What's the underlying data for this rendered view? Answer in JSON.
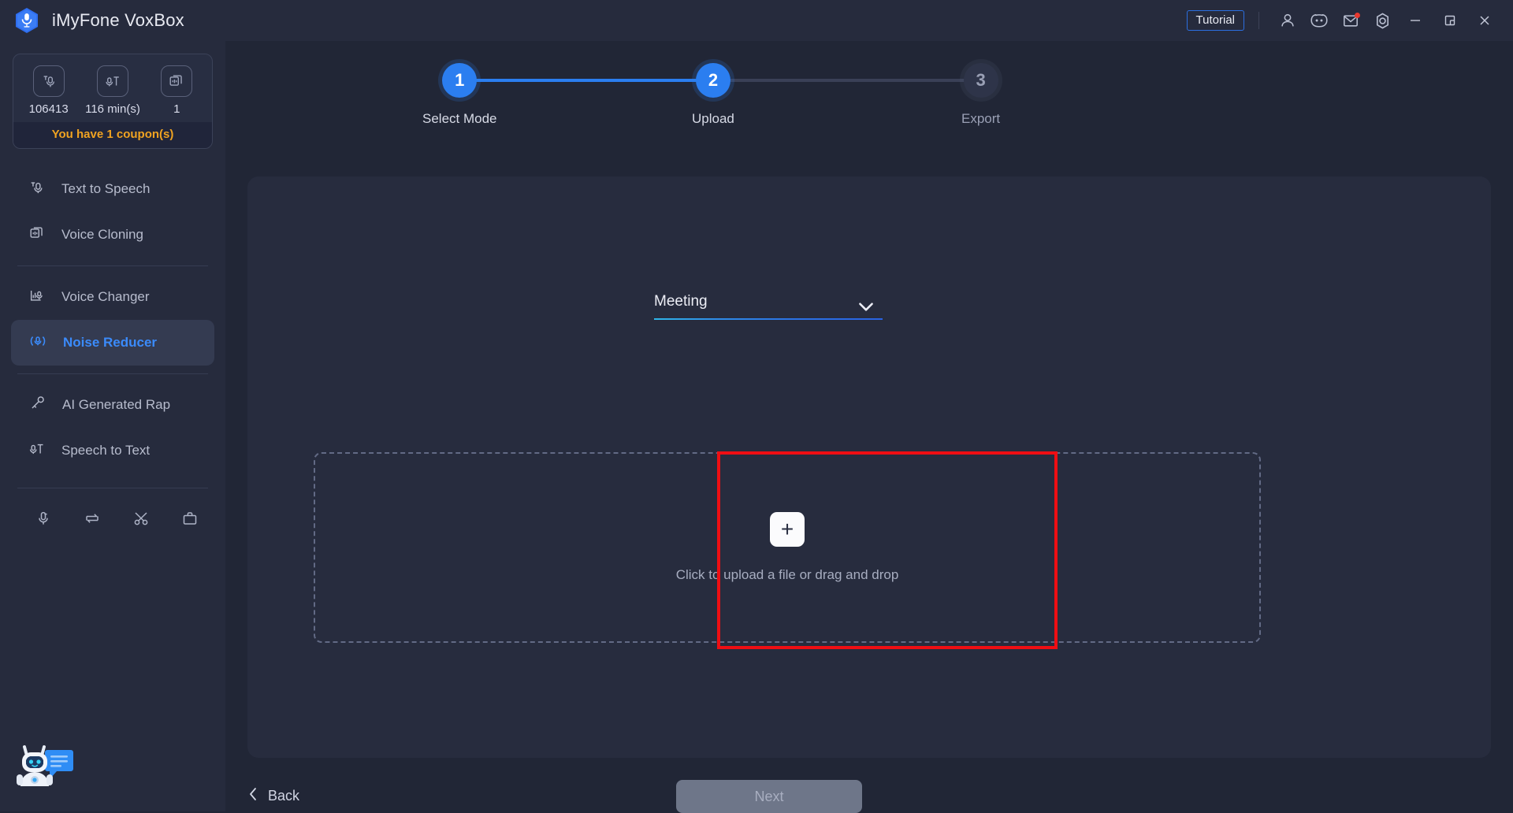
{
  "app": {
    "title": "iMyFone VoxBox",
    "logo_icon": "microphone-hexagon-logo"
  },
  "titlebar": {
    "tutorial_label": "Tutorial",
    "icons": [
      {
        "name": "account-icon"
      },
      {
        "name": "discord-icon"
      },
      {
        "name": "mail-icon",
        "badge": true
      },
      {
        "name": "settings-gear-icon"
      }
    ],
    "window_controls": [
      {
        "name": "minimize-button"
      },
      {
        "name": "maximize-button"
      },
      {
        "name": "close-button"
      }
    ]
  },
  "sidebar": {
    "credits": [
      {
        "icon": "text-to-speech-icon",
        "value": "106413"
      },
      {
        "icon": "speech-to-text-icon",
        "value": "116 min(s)"
      },
      {
        "icon": "voice-cloning-icon",
        "value": "1"
      }
    ],
    "coupon_text": "You have 1 coupon(s)",
    "items": [
      {
        "label": "Text to Speech",
        "icon": "text-to-speech-icon",
        "active": false
      },
      {
        "label": "Voice Cloning",
        "icon": "voice-cloning-icon",
        "active": false
      },
      {
        "label": "Voice Changer",
        "icon": "voice-changer-icon",
        "active": false
      },
      {
        "label": "Noise Reducer",
        "icon": "noise-reducer-icon",
        "active": true
      },
      {
        "label": "AI Generated Rap",
        "icon": "ai-rap-icon",
        "active": false
      },
      {
        "label": "Speech to Text",
        "icon": "speech-to-text-icon",
        "active": false
      }
    ],
    "quick_tools": [
      {
        "name": "recorder-icon"
      },
      {
        "name": "converter-icon"
      },
      {
        "name": "cutter-icon"
      },
      {
        "name": "toolbox-icon"
      }
    ],
    "chat_bot": "chat-bot-mascot"
  },
  "stepper": {
    "steps": [
      {
        "number": "1",
        "label": "Select Mode",
        "state": "active"
      },
      {
        "number": "2",
        "label": "Upload",
        "state": "active"
      },
      {
        "number": "3",
        "label": "Export",
        "state": "inactive"
      }
    ]
  },
  "main": {
    "mode_select": {
      "value": "Meeting",
      "chevron_icon": "chevron-down-icon"
    },
    "dropzone": {
      "plus_label": "+",
      "text": "Click to upload a file or drag and drop"
    }
  },
  "footer": {
    "back_label": "Back",
    "back_icon": "chevron-left-icon",
    "next_label": "Next"
  },
  "colors": {
    "accent_blue": "#2b7ef0",
    "coupon_orange": "#f0a321",
    "highlight_red": "#ef0e13",
    "window_bg": "#212636",
    "panel_bg": "#272c3e",
    "sidebar_bg": "#262b3d"
  }
}
